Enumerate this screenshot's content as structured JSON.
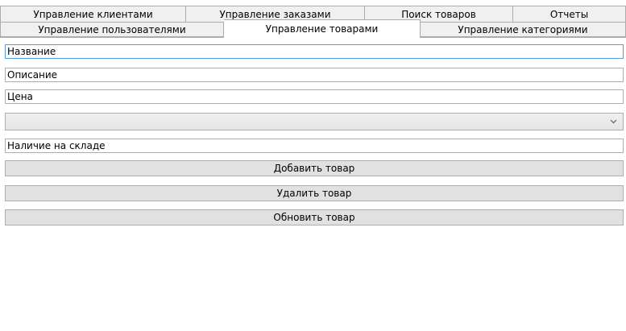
{
  "tabs": {
    "row1": [
      "Управление клиентами",
      "Управление заказами",
      "Поиск товаров",
      "Отчеты"
    ],
    "row2": [
      "Управление пользователями",
      "Управление товарами",
      "Управление категориями"
    ],
    "active": "Управление товарами"
  },
  "form": {
    "name_placeholder": "Название",
    "description_placeholder": "Описание",
    "price_placeholder": "Цена",
    "category_value": "",
    "stock_placeholder": "Наличие на складе",
    "add_button": "Добавить товар",
    "delete_button": "Удалить товар",
    "update_button": "Обновить товар"
  },
  "icons": {
    "combo_arrow": "chevron-down-icon"
  }
}
